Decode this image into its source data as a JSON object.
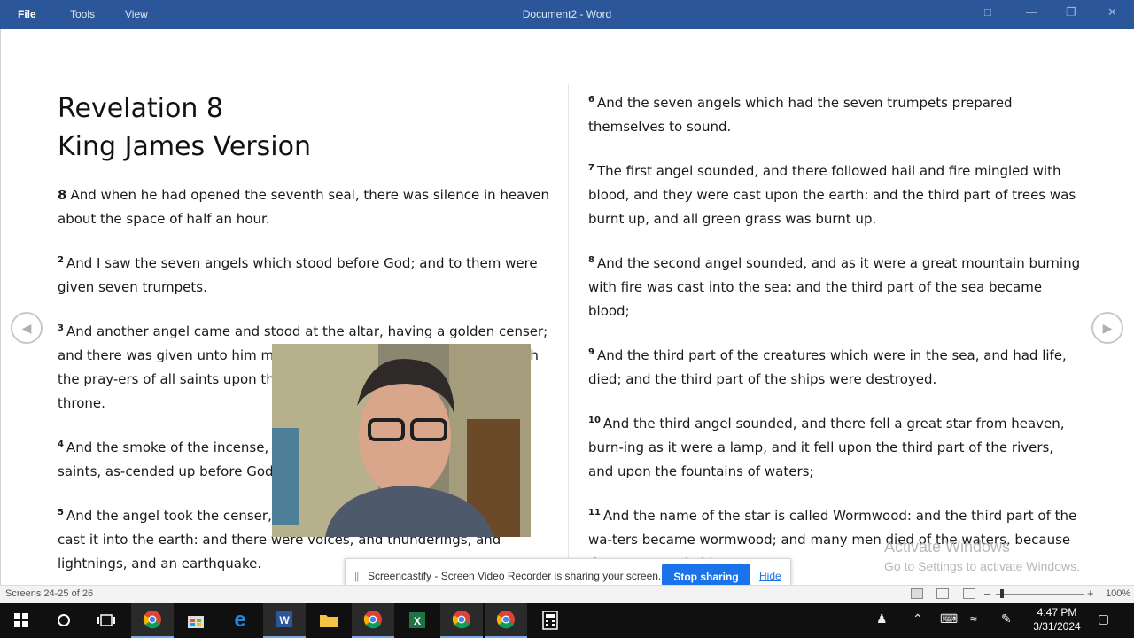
{
  "window": {
    "menus": [
      "File",
      "Tools",
      "View"
    ],
    "title": "Document2 - Word"
  },
  "document": {
    "heading_line1": "Revelation 8",
    "heading_line2": "King James Version",
    "left_verses": [
      {
        "num": "8",
        "text": "And when he had opened the seventh seal, there was silence in heaven about the space of half an hour."
      },
      {
        "num": "2",
        "text": "And I saw the seven angels which stood before God; and to them were given seven trumpets."
      },
      {
        "num": "3",
        "text": "And another angel came and stood at the altar, having a golden censer; and there was given unto him much incense, that he should offer it with the pray-ers of all saints upon the golden altar which was before the throne."
      },
      {
        "num": "4",
        "text": "And the smoke of the incense, which came with the prayers of the saints, as-cended up before God out of the angel's hand."
      },
      {
        "num": "5",
        "text": "And the angel took the censer, and filled it with fire of the altar, and cast it into the earth: and there were voices, and thunderings, and lightnings, and an earthquake."
      }
    ],
    "right_verses": [
      {
        "num": "6",
        "text": "And the seven angels which had the seven trumpets prepared themselves to sound."
      },
      {
        "num": "7",
        "text": "The first angel sounded, and there followed hail and fire mingled with blood, and they were cast upon the earth: and the third part of trees was burnt up, and all green grass was burnt up."
      },
      {
        "num": "8",
        "text": "And the second angel sounded, and as it were a great mountain burning with fire was cast into the sea: and the third part of the sea became blood;"
      },
      {
        "num": "9",
        "text": "And the third part of the creatures which were in the sea, and had life, died; and the third part of the ships were destroyed."
      },
      {
        "num": "10",
        "text": "And the third angel sounded, and there fell a great star from heaven, burn-ing as it were a lamp, and it fell upon the third part of the rivers, and upon the fountains of waters;"
      },
      {
        "num": "11",
        "text": "And the name of the star is called Wormwood: and the third part of the wa-ters became wormwood; and many men died of the waters, because they were made bitter."
      }
    ]
  },
  "activation": {
    "title": "Activate Windows",
    "subtitle": "Go to Settings to activate Windows."
  },
  "share_bar": {
    "message": "Screencastify - Screen Video Recorder is sharing your screen.",
    "stop_label": "Stop sharing",
    "hide_label": "Hide"
  },
  "status": {
    "screens": "Screens 24-25 of 26",
    "zoom_level": "100%",
    "zoom_fraction": 0.05
  },
  "taskbar": {
    "time": "4:47 PM",
    "date": "3/31/2024"
  },
  "colors": {
    "word_blue": "#2b579a",
    "button_blue": "#1a73e8"
  }
}
